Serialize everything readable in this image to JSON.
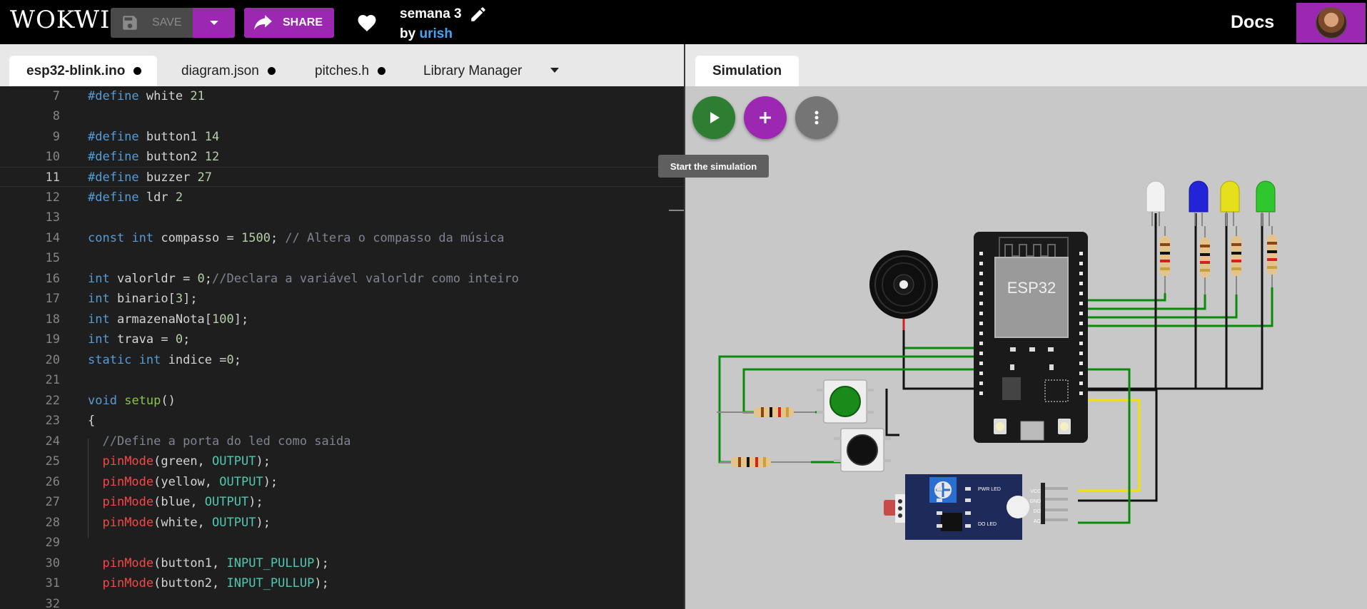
{
  "header": {
    "logo": "WOKWI",
    "save_label": "SAVE",
    "share_label": "SHARE",
    "project_title": "semana 3",
    "by_label": "by",
    "author": "urish",
    "docs_label": "Docs"
  },
  "editor": {
    "tabs": [
      {
        "label": "esp32-blink.ino",
        "active": true,
        "modified": true
      },
      {
        "label": "diagram.json",
        "active": false,
        "modified": true
      },
      {
        "label": "pitches.h",
        "active": false,
        "modified": true
      },
      {
        "label": "Library Manager",
        "active": false,
        "modified": false
      }
    ],
    "line_numbers": [
      "7",
      "8",
      "9",
      "10",
      "11",
      "12",
      "13",
      "14",
      "15",
      "16",
      "17",
      "18",
      "19",
      "20",
      "21",
      "22",
      "23",
      "24",
      "25",
      "26",
      "27",
      "28",
      "29",
      "30",
      "31",
      "32"
    ],
    "current_line": "11",
    "code_lines": [
      "#define white 21",
      "",
      "#define button1 14",
      "#define button2 12",
      "#define buzzer 27",
      "#define ldr 2",
      "",
      "const int compasso = 1500; // Altera o compasso da música",
      "",
      "int valorldr = 0;//Declara a variável valorldr como inteiro",
      "int binario[3];",
      "int armazenaNota[100];",
      "int trava = 0;",
      "static int indice =0;",
      "",
      "void setup()",
      "{",
      "  //Define a porta do led como saida",
      "  pinMode(green, OUTPUT);",
      "  pinMode(yellow, OUTPUT);",
      "  pinMode(blue, OUTPUT);",
      "  pinMode(white, OUTPUT);",
      "",
      "  pinMode(button1, INPUT_PULLUP);",
      "  pinMode(button2, INPUT_PULLUP);",
      ""
    ]
  },
  "simulation": {
    "tab_label": "Simulation",
    "tooltip": "Start the simulation",
    "board_label": "ESP32",
    "sensor_labels": [
      "PWR LED",
      "DO LED",
      "VCC",
      "GND",
      "DO",
      "AO"
    ],
    "colors": {
      "accent": "#9c27b0",
      "play": "#2e7d32",
      "menu": "#757575",
      "wire_green": "#0a8a0a",
      "wire_black": "#111111",
      "wire_yellow": "#f2e200"
    }
  },
  "icons": [
    "save-icon",
    "chevron-down-icon",
    "share-icon",
    "heart-icon",
    "pencil-icon",
    "play-icon",
    "plus-icon",
    "more-vertical-icon"
  ]
}
